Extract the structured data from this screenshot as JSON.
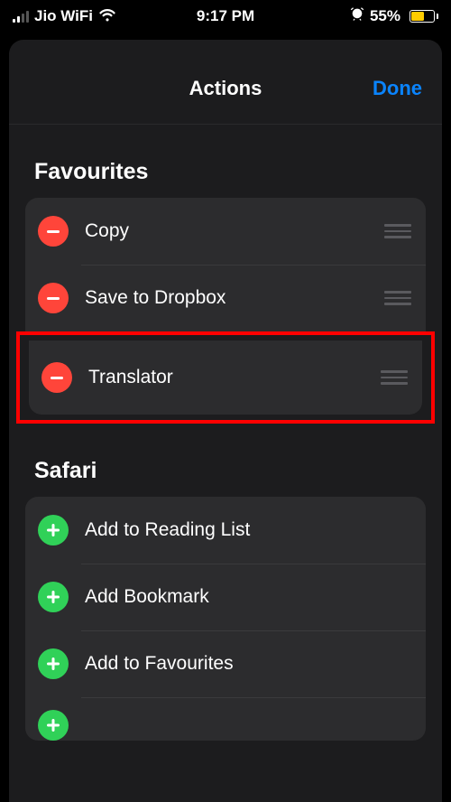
{
  "status": {
    "carrier": "Jio WiFi",
    "time": "9:17 PM",
    "battery_pct": "55%"
  },
  "nav": {
    "title": "Actions",
    "done": "Done"
  },
  "sections": {
    "favourites": {
      "title": "Favourites",
      "items": [
        {
          "label": "Copy"
        },
        {
          "label": "Save to Dropbox"
        },
        {
          "label": "Translator"
        }
      ]
    },
    "safari": {
      "title": "Safari",
      "items": [
        {
          "label": "Add to Reading List"
        },
        {
          "label": "Add Bookmark"
        },
        {
          "label": "Add to Favourites"
        }
      ]
    }
  }
}
